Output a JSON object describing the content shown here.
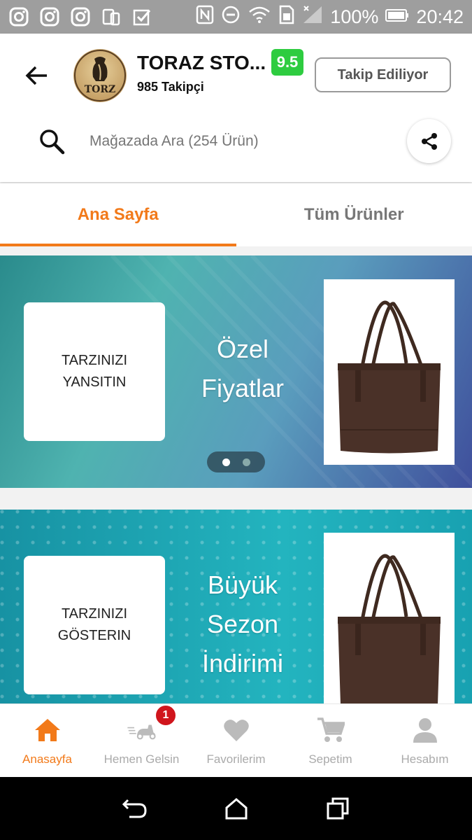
{
  "status_bar": {
    "icons": [
      "instagram-icon",
      "instagram-icon",
      "instagram-icon",
      "devices-icon",
      "checkbox-icon"
    ],
    "battery": "100%",
    "time": "20:42"
  },
  "store": {
    "name": "TORAZ STO...",
    "logo_text": "TORZ",
    "score": "9.5",
    "followers": "985 Takipçi",
    "follow_button": "Takip Ediliyor"
  },
  "search": {
    "placeholder": "Mağazada Ara (254 Ürün)"
  },
  "tabs": [
    {
      "label": "Ana Sayfa",
      "active": true
    },
    {
      "label": "Tüm Ürünler",
      "active": false
    }
  ],
  "banners": [
    {
      "card_text": "TARZINIZI\nYANSITIN",
      "headline": "Özel\nFiyatlar"
    },
    {
      "card_text": "TARZINIZI\nGÖSTERIN",
      "headline": "Büyük\nSezon\nİndirimi"
    }
  ],
  "carousel": {
    "total": 2,
    "active_index": 0
  },
  "bottom_nav": [
    {
      "label": "Anasayfa",
      "icon": "home-icon",
      "active": true
    },
    {
      "label": "Hemen Gelsin",
      "icon": "scooter-icon",
      "badge": "1"
    },
    {
      "label": "Favorilerim",
      "icon": "heart-icon"
    },
    {
      "label": "Sepetim",
      "icon": "cart-icon"
    },
    {
      "label": "Hesabım",
      "icon": "person-icon"
    }
  ],
  "colors": {
    "accent": "#f27a1a",
    "score_green": "#2ecc40",
    "badge_red": "#d0151c"
  }
}
